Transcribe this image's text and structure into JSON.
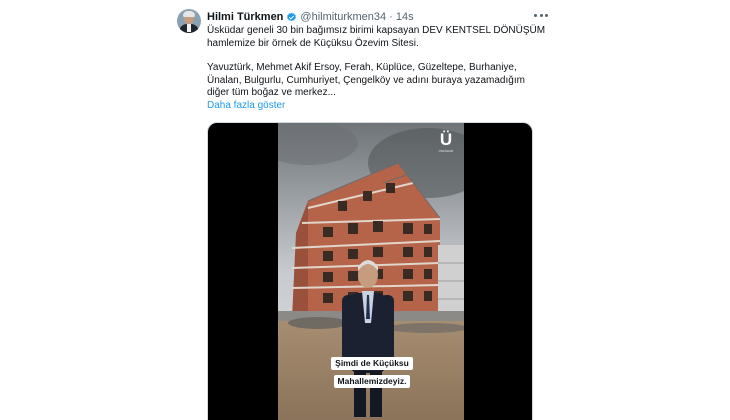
{
  "author": {
    "name": "Hilmi Türkmen",
    "handle": "@hilmiturkmen34",
    "separator": "·",
    "time": "14s"
  },
  "tweet": {
    "line1": "Üsküdar geneli 30 bin bağımsız birimi kapsayan DEV KENTSEL DÖNÜŞÜM",
    "line2": "hamlemize bir örnek de Küçüksu Özevim Sitesi.",
    "line3": "Yavuztürk, Mehmet Akif Ersoy, Ferah, Küplüce, Güzeltepe, Burhaniye,",
    "line4": "Ünalan, Bulgurlu, Cumhuriyet, Çengelköy ve adını buraya yazamadığım",
    "line5": "diğer tüm boğaz ve merkez...",
    "show_more": "Daha fazla göster"
  },
  "video": {
    "brand_mark": "Ü",
    "brand_sub": "ÜSKÜDAR",
    "subtitle_line1": "Şimdi de Küçüksu",
    "subtitle_line2": "Mahallemizdeyiz."
  },
  "colors": {
    "link": "#1d9bf0",
    "verified": "#1d9bf0",
    "secondary_text": "#536471"
  },
  "icons": {
    "verified": "verified-badge-icon",
    "menu": "more-options-icon"
  }
}
